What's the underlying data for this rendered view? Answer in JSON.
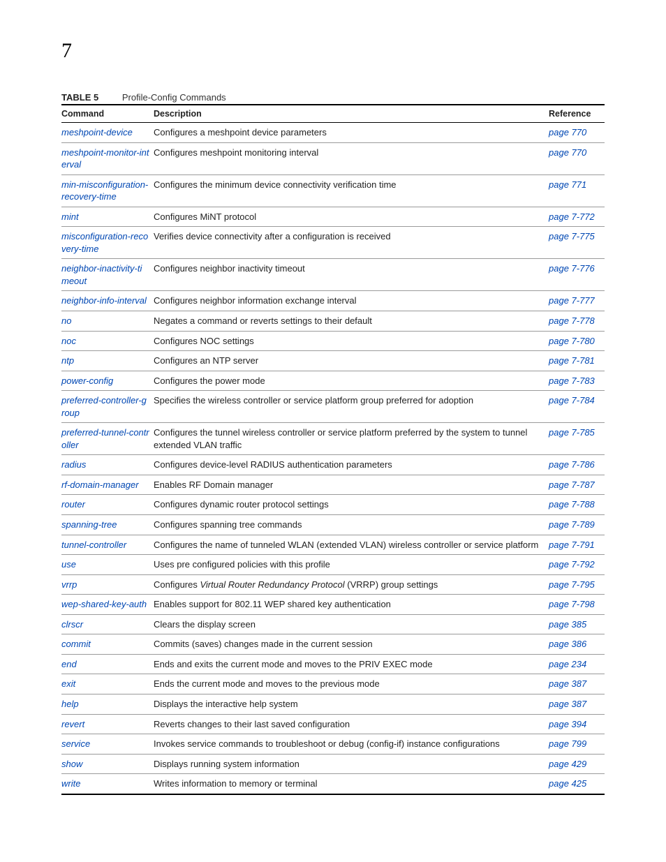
{
  "page_number": "7",
  "table_label": "TABLE 5",
  "table_title": "Profile-Config Commands",
  "headers": {
    "command": "Command",
    "description": "Description",
    "reference": "Reference"
  },
  "rows": [
    {
      "command": "meshpoint-device",
      "description": "Configures a meshpoint device parameters",
      "reference": "page 770"
    },
    {
      "command": "meshpoint-monitor-interval",
      "description": "Configures meshpoint monitoring interval",
      "reference": "page 770"
    },
    {
      "command": "min-misconfiguration-recovery-time",
      "description": "Configures the minimum device connectivity verification time",
      "reference": "page 771"
    },
    {
      "command": "mint",
      "description": "Configures MiNT protocol",
      "reference": "page 7-772"
    },
    {
      "command": "misconfiguration-recovery-time",
      "description": "Verifies device connectivity after a configuration is received",
      "reference": "page 7-775"
    },
    {
      "command": "neighbor-inactivity-timeout",
      "description": "Configures neighbor inactivity timeout",
      "reference": "page 7-776"
    },
    {
      "command": "neighbor-info-interval",
      "description": "Configures neighbor information exchange interval",
      "reference": "page 7-777"
    },
    {
      "command": "no",
      "description": "Negates a command or reverts settings to their default",
      "reference": "page 7-778"
    },
    {
      "command": "noc",
      "description": "Configures NOC settings",
      "reference": "page 7-780"
    },
    {
      "command": "ntp",
      "description": "Configures an NTP server",
      "reference": "page 7-781"
    },
    {
      "command": "power-config",
      "description": "Configures the power mode",
      "reference": "page 7-783"
    },
    {
      "command": "preferred-controller-group",
      "description": "Specifies the wireless controller or service platform group preferred for adoption",
      "reference": "page 7-784"
    },
    {
      "command": "preferred-tunnel-controller",
      "description": "Configures the tunnel wireless controller or service platform preferred by the system to tunnel extended VLAN traffic",
      "reference": "page 7-785"
    },
    {
      "command": "radius",
      "description": "Configures device-level RADIUS authentication parameters",
      "reference": "page 7-786"
    },
    {
      "command": "rf-domain-manager",
      "description": "Enables RF Domain manager",
      "reference": "page 7-787"
    },
    {
      "command": "router",
      "description": "Configures dynamic router protocol settings",
      "reference": "page 7-788"
    },
    {
      "command": "spanning-tree",
      "description": "Configures spanning tree commands",
      "reference": "page 7-789"
    },
    {
      "command": "tunnel-controller",
      "description": "Configures the name of tunneled WLAN (extended VLAN) wireless controller or service platform",
      "reference": "page 7-791"
    },
    {
      "command": "use",
      "description": "Uses pre configured policies with this profile",
      "reference": "page 7-792"
    },
    {
      "command": "vrrp",
      "desc_pre": "Configures ",
      "desc_ital": "Virtual Router Redundancy Protocol",
      "desc_post": " (VRRP) group settings",
      "reference": "page 7-795"
    },
    {
      "command": "wep-shared-key-auth",
      "description": "Enables support for 802.11 WEP shared key authentication",
      "reference": "page 7-798"
    },
    {
      "command": "clrscr",
      "description": "Clears the display screen",
      "reference": "page 385"
    },
    {
      "command": "commit",
      "description": "Commits (saves) changes made in the current session",
      "reference": "page 386"
    },
    {
      "command": "end",
      "description": "Ends and exits the current mode and moves to the PRIV EXEC mode",
      "reference": "page 234"
    },
    {
      "command": "exit",
      "description": "Ends the current mode and moves to the previous mode",
      "reference": "page 387"
    },
    {
      "command": "help",
      "description": "Displays the interactive help system",
      "reference": "page 387"
    },
    {
      "command": "revert",
      "description": "Reverts changes to their last saved configuration",
      "reference": "page 394"
    },
    {
      "command": "service",
      "description": "Invokes service commands to troubleshoot or debug (config-if) instance configurations",
      "reference": "page 799"
    },
    {
      "command": "show",
      "description": "Displays running system information",
      "reference": "page 429"
    },
    {
      "command": "write",
      "description": "Writes information to memory or terminal",
      "reference": "page 425"
    }
  ]
}
